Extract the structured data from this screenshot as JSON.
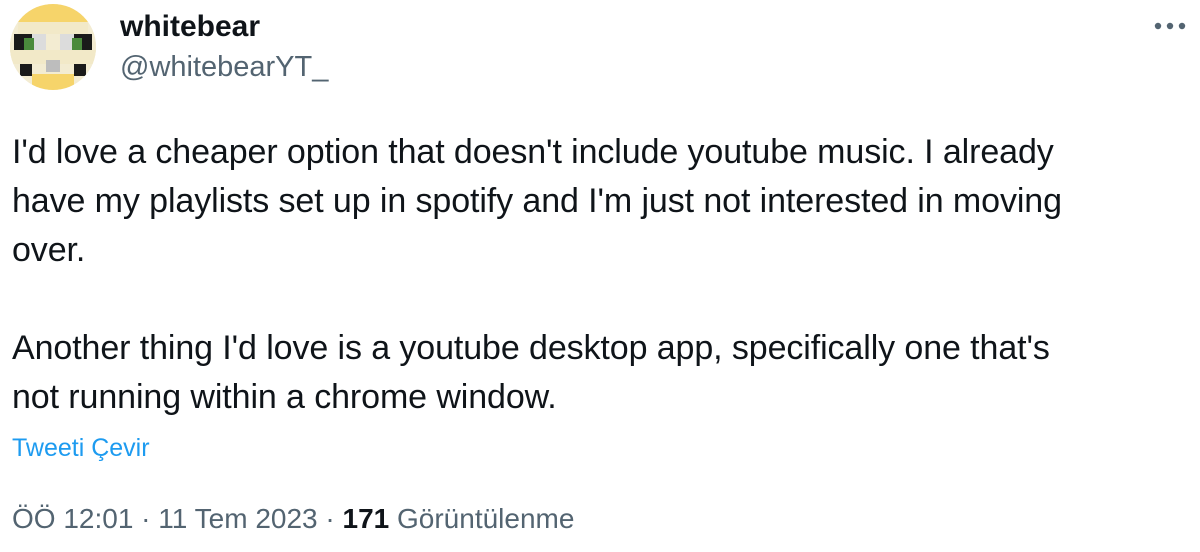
{
  "author": {
    "display_name": "whitebear",
    "handle": "@whitebearYT_"
  },
  "tweet": {
    "text": "I'd love a cheaper option that doesn't include youtube music. I already\nhave my playlists set up in spotify and I'm just not interested in moving\nover.\n\nAnother thing I'd love is a youtube desktop app, specifically one that's\nnot running within a chrome window.",
    "translate_label": "Tweeti Çevir"
  },
  "meta": {
    "time": "ÖÖ 12:01",
    "separator": " · ",
    "date": "11 Tem 2023",
    "views_count": "171",
    "views_label": "Görüntülenme"
  },
  "icons": {
    "more": "more-horizontal-icon",
    "avatar": "pixel-art-avatar"
  },
  "colors": {
    "text_primary": "#0f1419",
    "text_secondary": "#536471",
    "link": "#1d9bf0",
    "background": "#ffffff"
  }
}
